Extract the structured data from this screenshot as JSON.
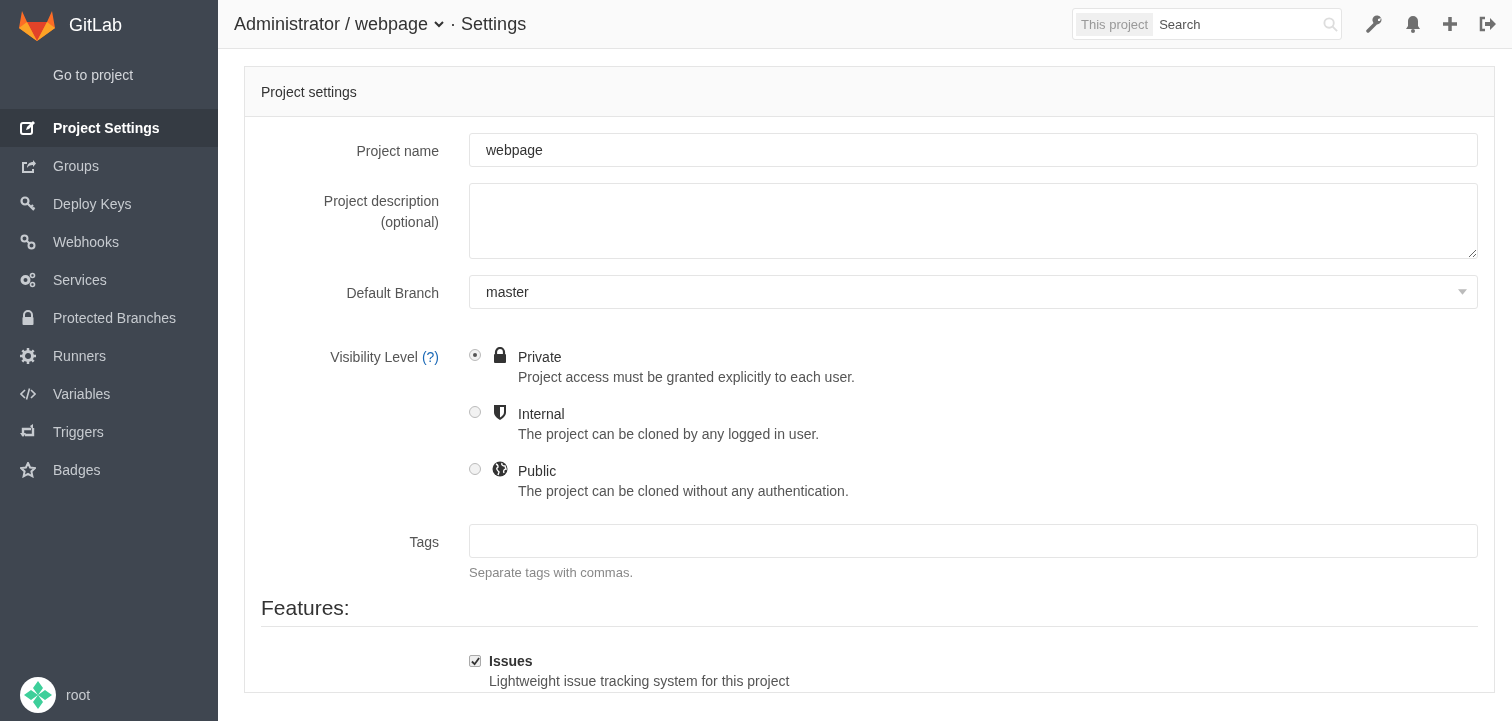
{
  "header": {
    "breadcrumb": "Administrator / webpage",
    "page": "· Settings",
    "search": {
      "scope": "This project",
      "placeholder": "Search"
    }
  },
  "sidebar": {
    "brand": "GitLab",
    "back_link": "Go to project",
    "items": [
      {
        "label": "Project Settings",
        "selected": true
      },
      {
        "label": "Groups",
        "selected": false
      },
      {
        "label": "Deploy Keys",
        "selected": false
      },
      {
        "label": "Webhooks",
        "selected": false
      },
      {
        "label": "Services",
        "selected": false
      },
      {
        "label": "Protected Branches",
        "selected": false
      },
      {
        "label": "Runners",
        "selected": false
      },
      {
        "label": "Variables",
        "selected": false
      },
      {
        "label": "Triggers",
        "selected": false
      },
      {
        "label": "Badges",
        "selected": false
      }
    ],
    "user": "root"
  },
  "panel": {
    "title": "Project settings",
    "fields": [
      {
        "kind": "text",
        "label": "Project name",
        "value": "webpage"
      },
      {
        "kind": "textarea",
        "label": "Project description (optional)"
      },
      {
        "kind": "select",
        "label": "Default Branch",
        "value": "master"
      },
      {
        "kind": "radio",
        "label": "Visibility Level",
        "help": "(?)",
        "options": [
          {
            "label": "Private",
            "description": "Project access must be granted explicitly to each user.",
            "selected": true
          },
          {
            "label": "Internal",
            "description": "The project can be cloned by any logged in user.",
            "selected": false
          },
          {
            "label": "Public",
            "description": "The project can be cloned without any authentication.",
            "selected": false
          }
        ]
      },
      {
        "kind": "text",
        "label": "Tags",
        "hint": "Separate tags with commas."
      }
    ]
  },
  "features": {
    "title": "Features:",
    "items": [
      {
        "label": "Issues",
        "description": "Lightweight issue tracking system for this project",
        "checked": true
      }
    ]
  }
}
